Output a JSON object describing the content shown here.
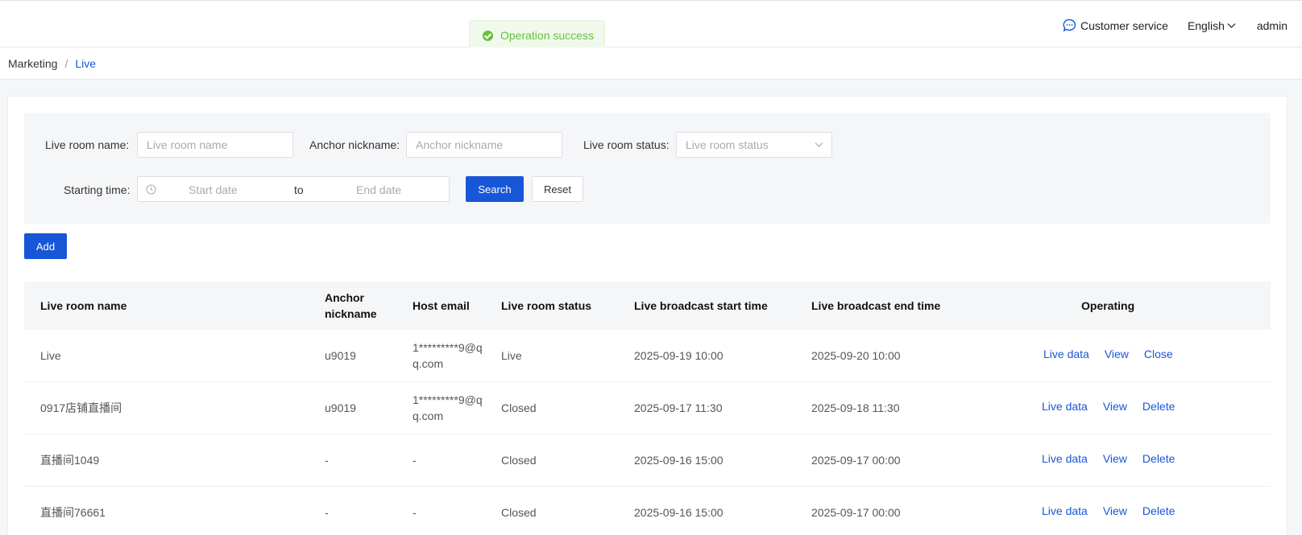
{
  "header": {
    "customer_service": "Customer service",
    "language": "English",
    "user": "admin"
  },
  "toast": {
    "message": "Operation success"
  },
  "breadcrumb": {
    "parent": "Marketing",
    "separator": "/",
    "current": "Live"
  },
  "filter": {
    "room_name_label": "Live room name:",
    "room_name_placeholder": "Live room name",
    "anchor_label": "Anchor nickname:",
    "anchor_placeholder": "Anchor nickname",
    "status_label": "Live room status:",
    "status_placeholder": "Live room status",
    "time_label": "Starting time:",
    "start_placeholder": "Start date",
    "range_sep": "to",
    "end_placeholder": "End date",
    "search": "Search",
    "reset": "Reset"
  },
  "toolbar": {
    "add": "Add"
  },
  "table": {
    "columns": [
      "Live room name",
      "Anchor nickname",
      "Host email",
      "Live room status",
      "Live broadcast start time",
      "Live broadcast end time",
      "Operating"
    ],
    "rows": [
      {
        "name": "Live",
        "anchor": "u9019",
        "email": "1*********9@qq.com",
        "status": "Live",
        "start": "2025-09-19 10:00",
        "end": "2025-09-20 10:00",
        "ops": [
          "Live data",
          "View",
          "Close"
        ]
      },
      {
        "name": "0917店铺直播间",
        "anchor": "u9019",
        "email": "1*********9@qq.com",
        "status": "Closed",
        "start": "2025-09-17 11:30",
        "end": "2025-09-18 11:30",
        "ops": [
          "Live data",
          "View",
          "Delete"
        ]
      },
      {
        "name": "直播间1049",
        "anchor": "-",
        "email": "-",
        "status": "Closed",
        "start": "2025-09-16 15:00",
        "end": "2025-09-17 00:00",
        "ops": [
          "Live data",
          "View",
          "Delete"
        ]
      },
      {
        "name": "直播间76661",
        "anchor": "-",
        "email": "-",
        "status": "Closed",
        "start": "2025-09-16 15:00",
        "end": "2025-09-17 00:00",
        "ops": [
          "Live data",
          "View",
          "Delete"
        ]
      }
    ]
  },
  "colors": {
    "primary": "#1856d8",
    "success": "#67c23a",
    "panel": "#f5f6f8"
  },
  "icons": {
    "customer_service": "chat-bubble-icon",
    "language": "chevron-down-icon",
    "select": "chevron-down-icon",
    "date": "clock-icon",
    "toast": "check-circle-icon"
  }
}
